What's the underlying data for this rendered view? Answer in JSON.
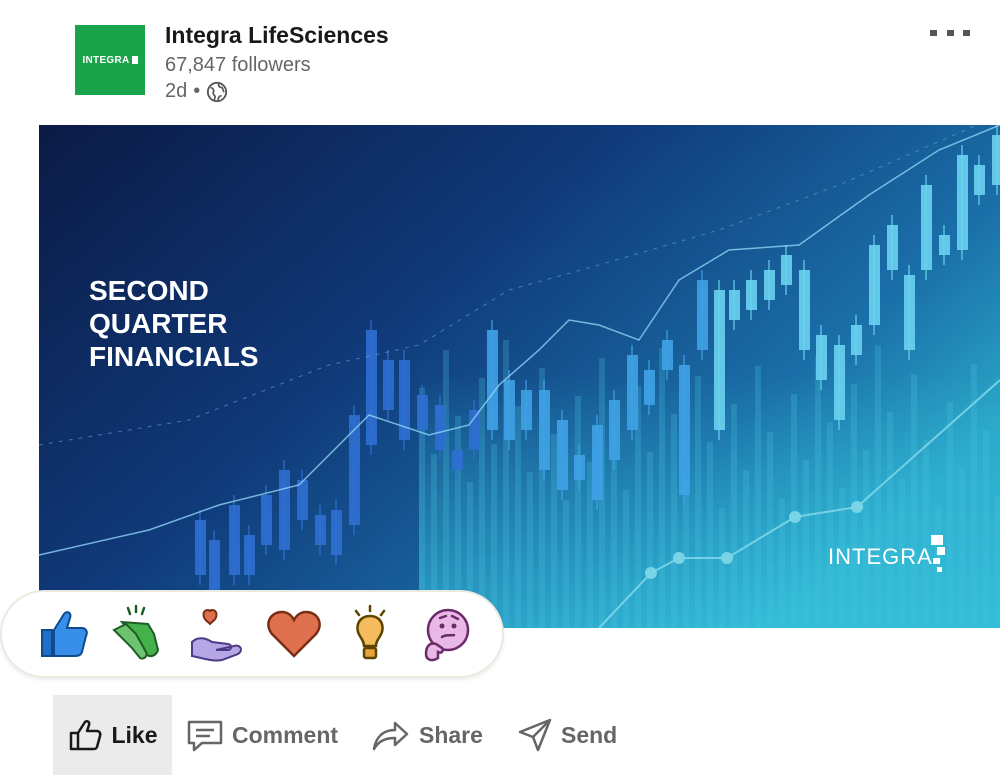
{
  "post": {
    "author": "Integra LifeSciences",
    "followers": "67,847 followers",
    "time_ago": "2d",
    "separator": "•",
    "visibility_icon": "globe-icon",
    "more_icon": "ellipsis-icon",
    "logo_text": "INTEGRA",
    "logo_color": "#1aa34a"
  },
  "image": {
    "headline": [
      "SECOND",
      "QUARTER",
      "FINANCIALS"
    ],
    "brand": "INTEGRA"
  },
  "reactions": [
    {
      "name": "like",
      "icon": "thumbs-up-icon"
    },
    {
      "name": "celebrate",
      "icon": "clapping-hands-icon"
    },
    {
      "name": "support",
      "icon": "heart-hand-icon"
    },
    {
      "name": "love",
      "icon": "heart-icon"
    },
    {
      "name": "insightful",
      "icon": "lightbulb-icon"
    },
    {
      "name": "curious",
      "icon": "thinking-face-icon"
    }
  ],
  "actions": {
    "like": "Like",
    "comment": "Comment",
    "share": "Share",
    "send": "Send"
  },
  "colors": {
    "text_primary": "#191919",
    "text_secondary": "#666666",
    "active_bg": "#ebebeb"
  }
}
